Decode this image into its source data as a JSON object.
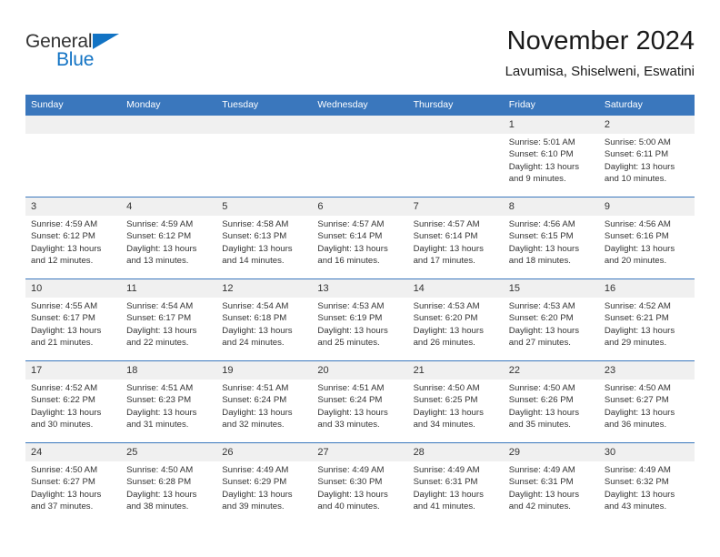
{
  "brand": {
    "name_part1": "General",
    "name_part2": "Blue",
    "flag_icon": "triangle-flag-icon"
  },
  "header": {
    "month_title": "November 2024",
    "location": "Lavumisa, Shiselweni, Eswatini"
  },
  "colors": {
    "header_blue": "#3a77bd",
    "brand_blue": "#1273c4",
    "daynum_band": "#f0f0f0",
    "text": "#333333"
  },
  "calendar": {
    "weekday_headers": [
      "Sunday",
      "Monday",
      "Tuesday",
      "Wednesday",
      "Thursday",
      "Friday",
      "Saturday"
    ],
    "weeks": [
      [
        {
          "day": "",
          "blank": true
        },
        {
          "day": "",
          "blank": true
        },
        {
          "day": "",
          "blank": true
        },
        {
          "day": "",
          "blank": true
        },
        {
          "day": "",
          "blank": true
        },
        {
          "day": "1",
          "sunrise": "Sunrise: 5:01 AM",
          "sunset": "Sunset: 6:10 PM",
          "daylight_line1": "Daylight: 13 hours",
          "daylight_line2": "and 9 minutes."
        },
        {
          "day": "2",
          "sunrise": "Sunrise: 5:00 AM",
          "sunset": "Sunset: 6:11 PM",
          "daylight_line1": "Daylight: 13 hours",
          "daylight_line2": "and 10 minutes."
        }
      ],
      [
        {
          "day": "3",
          "sunrise": "Sunrise: 4:59 AM",
          "sunset": "Sunset: 6:12 PM",
          "daylight_line1": "Daylight: 13 hours",
          "daylight_line2": "and 12 minutes."
        },
        {
          "day": "4",
          "sunrise": "Sunrise: 4:59 AM",
          "sunset": "Sunset: 6:12 PM",
          "daylight_line1": "Daylight: 13 hours",
          "daylight_line2": "and 13 minutes."
        },
        {
          "day": "5",
          "sunrise": "Sunrise: 4:58 AM",
          "sunset": "Sunset: 6:13 PM",
          "daylight_line1": "Daylight: 13 hours",
          "daylight_line2": "and 14 minutes."
        },
        {
          "day": "6",
          "sunrise": "Sunrise: 4:57 AM",
          "sunset": "Sunset: 6:14 PM",
          "daylight_line1": "Daylight: 13 hours",
          "daylight_line2": "and 16 minutes."
        },
        {
          "day": "7",
          "sunrise": "Sunrise: 4:57 AM",
          "sunset": "Sunset: 6:14 PM",
          "daylight_line1": "Daylight: 13 hours",
          "daylight_line2": "and 17 minutes."
        },
        {
          "day": "8",
          "sunrise": "Sunrise: 4:56 AM",
          "sunset": "Sunset: 6:15 PM",
          "daylight_line1": "Daylight: 13 hours",
          "daylight_line2": "and 18 minutes."
        },
        {
          "day": "9",
          "sunrise": "Sunrise: 4:56 AM",
          "sunset": "Sunset: 6:16 PM",
          "daylight_line1": "Daylight: 13 hours",
          "daylight_line2": "and 20 minutes."
        }
      ],
      [
        {
          "day": "10",
          "sunrise": "Sunrise: 4:55 AM",
          "sunset": "Sunset: 6:17 PM",
          "daylight_line1": "Daylight: 13 hours",
          "daylight_line2": "and 21 minutes."
        },
        {
          "day": "11",
          "sunrise": "Sunrise: 4:54 AM",
          "sunset": "Sunset: 6:17 PM",
          "daylight_line1": "Daylight: 13 hours",
          "daylight_line2": "and 22 minutes."
        },
        {
          "day": "12",
          "sunrise": "Sunrise: 4:54 AM",
          "sunset": "Sunset: 6:18 PM",
          "daylight_line1": "Daylight: 13 hours",
          "daylight_line2": "and 24 minutes."
        },
        {
          "day": "13",
          "sunrise": "Sunrise: 4:53 AM",
          "sunset": "Sunset: 6:19 PM",
          "daylight_line1": "Daylight: 13 hours",
          "daylight_line2": "and 25 minutes."
        },
        {
          "day": "14",
          "sunrise": "Sunrise: 4:53 AM",
          "sunset": "Sunset: 6:20 PM",
          "daylight_line1": "Daylight: 13 hours",
          "daylight_line2": "and 26 minutes."
        },
        {
          "day": "15",
          "sunrise": "Sunrise: 4:53 AM",
          "sunset": "Sunset: 6:20 PM",
          "daylight_line1": "Daylight: 13 hours",
          "daylight_line2": "and 27 minutes."
        },
        {
          "day": "16",
          "sunrise": "Sunrise: 4:52 AM",
          "sunset": "Sunset: 6:21 PM",
          "daylight_line1": "Daylight: 13 hours",
          "daylight_line2": "and 29 minutes."
        }
      ],
      [
        {
          "day": "17",
          "sunrise": "Sunrise: 4:52 AM",
          "sunset": "Sunset: 6:22 PM",
          "daylight_line1": "Daylight: 13 hours",
          "daylight_line2": "and 30 minutes."
        },
        {
          "day": "18",
          "sunrise": "Sunrise: 4:51 AM",
          "sunset": "Sunset: 6:23 PM",
          "daylight_line1": "Daylight: 13 hours",
          "daylight_line2": "and 31 minutes."
        },
        {
          "day": "19",
          "sunrise": "Sunrise: 4:51 AM",
          "sunset": "Sunset: 6:24 PM",
          "daylight_line1": "Daylight: 13 hours",
          "daylight_line2": "and 32 minutes."
        },
        {
          "day": "20",
          "sunrise": "Sunrise: 4:51 AM",
          "sunset": "Sunset: 6:24 PM",
          "daylight_line1": "Daylight: 13 hours",
          "daylight_line2": "and 33 minutes."
        },
        {
          "day": "21",
          "sunrise": "Sunrise: 4:50 AM",
          "sunset": "Sunset: 6:25 PM",
          "daylight_line1": "Daylight: 13 hours",
          "daylight_line2": "and 34 minutes."
        },
        {
          "day": "22",
          "sunrise": "Sunrise: 4:50 AM",
          "sunset": "Sunset: 6:26 PM",
          "daylight_line1": "Daylight: 13 hours",
          "daylight_line2": "and 35 minutes."
        },
        {
          "day": "23",
          "sunrise": "Sunrise: 4:50 AM",
          "sunset": "Sunset: 6:27 PM",
          "daylight_line1": "Daylight: 13 hours",
          "daylight_line2": "and 36 minutes."
        }
      ],
      [
        {
          "day": "24",
          "sunrise": "Sunrise: 4:50 AM",
          "sunset": "Sunset: 6:27 PM",
          "daylight_line1": "Daylight: 13 hours",
          "daylight_line2": "and 37 minutes."
        },
        {
          "day": "25",
          "sunrise": "Sunrise: 4:50 AM",
          "sunset": "Sunset: 6:28 PM",
          "daylight_line1": "Daylight: 13 hours",
          "daylight_line2": "and 38 minutes."
        },
        {
          "day": "26",
          "sunrise": "Sunrise: 4:49 AM",
          "sunset": "Sunset: 6:29 PM",
          "daylight_line1": "Daylight: 13 hours",
          "daylight_line2": "and 39 minutes."
        },
        {
          "day": "27",
          "sunrise": "Sunrise: 4:49 AM",
          "sunset": "Sunset: 6:30 PM",
          "daylight_line1": "Daylight: 13 hours",
          "daylight_line2": "and 40 minutes."
        },
        {
          "day": "28",
          "sunrise": "Sunrise: 4:49 AM",
          "sunset": "Sunset: 6:31 PM",
          "daylight_line1": "Daylight: 13 hours",
          "daylight_line2": "and 41 minutes."
        },
        {
          "day": "29",
          "sunrise": "Sunrise: 4:49 AM",
          "sunset": "Sunset: 6:31 PM",
          "daylight_line1": "Daylight: 13 hours",
          "daylight_line2": "and 42 minutes."
        },
        {
          "day": "30",
          "sunrise": "Sunrise: 4:49 AM",
          "sunset": "Sunset: 6:32 PM",
          "daylight_line1": "Daylight: 13 hours",
          "daylight_line2": "and 43 minutes."
        }
      ]
    ]
  }
}
